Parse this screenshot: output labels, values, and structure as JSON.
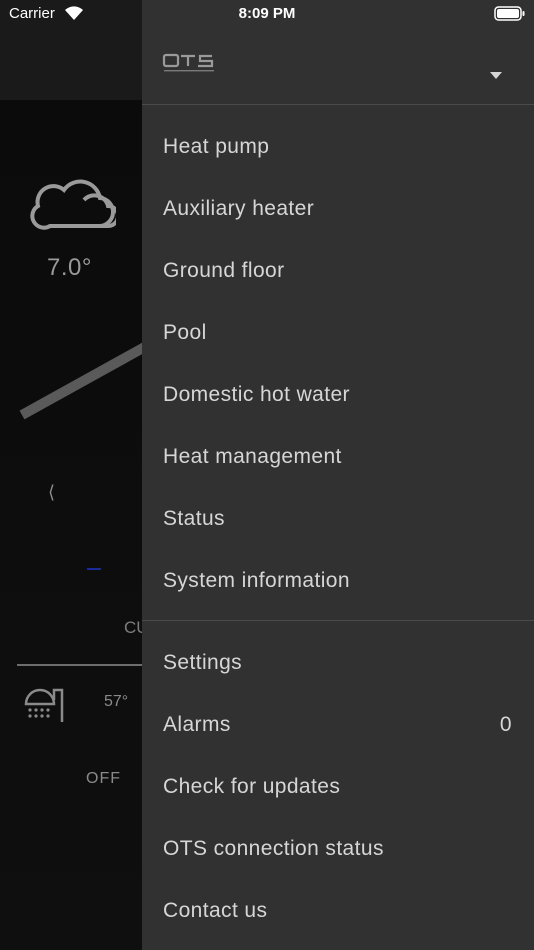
{
  "status_bar": {
    "carrier": "Carrier",
    "time": "8:09 PM"
  },
  "background": {
    "weather_icon": "cloud-icon",
    "temperature": "7.0°",
    "prev_arrow": "⟨",
    "section_label": "CU",
    "dhw_icon": "shower-icon",
    "dhw_temperature": "57°",
    "dhw_state": "OFF"
  },
  "drawer": {
    "logo_icon": "ots-logo-icon",
    "menu_primary": [
      {
        "label": "Heat pump"
      },
      {
        "label": "Auxiliary heater"
      },
      {
        "label": "Ground floor"
      },
      {
        "label": "Pool"
      },
      {
        "label": "Domestic hot water"
      },
      {
        "label": "Heat management"
      },
      {
        "label": "Status"
      },
      {
        "label": "System information"
      }
    ],
    "menu_secondary": [
      {
        "label": "Settings"
      },
      {
        "label": "Alarms",
        "badge": "0"
      },
      {
        "label": "Check for updates"
      },
      {
        "label": "OTS connection status"
      },
      {
        "label": "Contact us"
      }
    ]
  },
  "colors": {
    "drawer_bg": "#313131",
    "text": "#d6d6d6",
    "divider": "#4a4a4a",
    "accent_blue": "#1a2a9a"
  }
}
